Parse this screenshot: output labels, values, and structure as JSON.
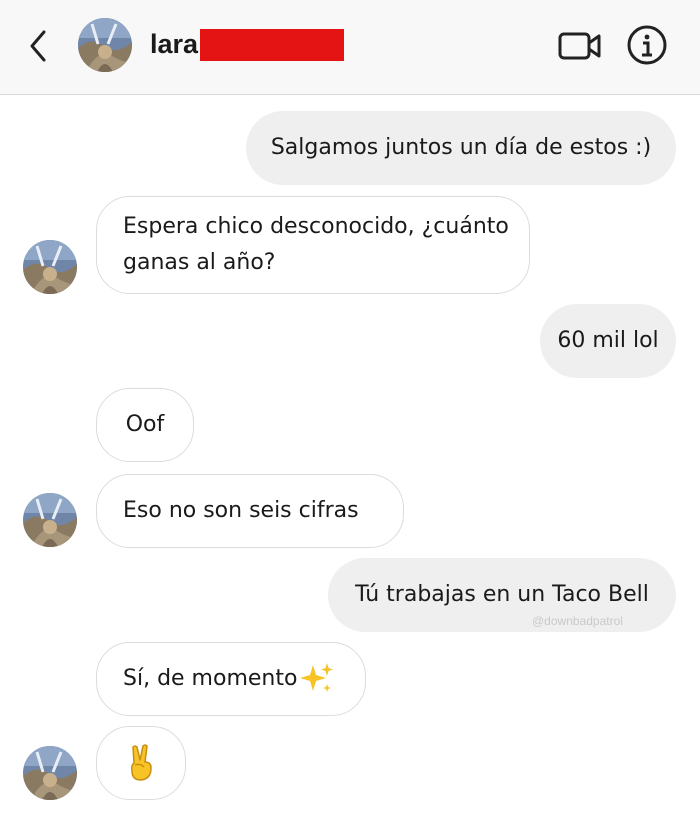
{
  "header": {
    "name": "lara",
    "icons": {
      "back": "chevron-left-icon",
      "video": "video-camera-icon",
      "info": "info-icon"
    }
  },
  "messages": [
    {
      "side": "sent",
      "text": "Salgamos juntos un día de estos :)"
    },
    {
      "side": "received",
      "lines": [
        "Espera chico desconocido, ¿cuánto",
        "ganas al año?"
      ]
    },
    {
      "side": "sent",
      "text": "60 mil lol"
    },
    {
      "side": "received",
      "text": "Oof"
    },
    {
      "side": "received",
      "text": "Eso no son seis cifras"
    },
    {
      "side": "sent",
      "text": "Tú trabajas en un Taco Bell"
    },
    {
      "side": "received",
      "text": "Sí, de momento",
      "emoji": "sparkles-icon"
    },
    {
      "side": "received",
      "text": "✌️",
      "emoji": "victory-hand-icon"
    }
  ],
  "watermark": "@downbadpatrol",
  "colors": {
    "sent_bubble": "#efefef",
    "received_border": "#dcdcdc",
    "redaction": "#e41414"
  }
}
